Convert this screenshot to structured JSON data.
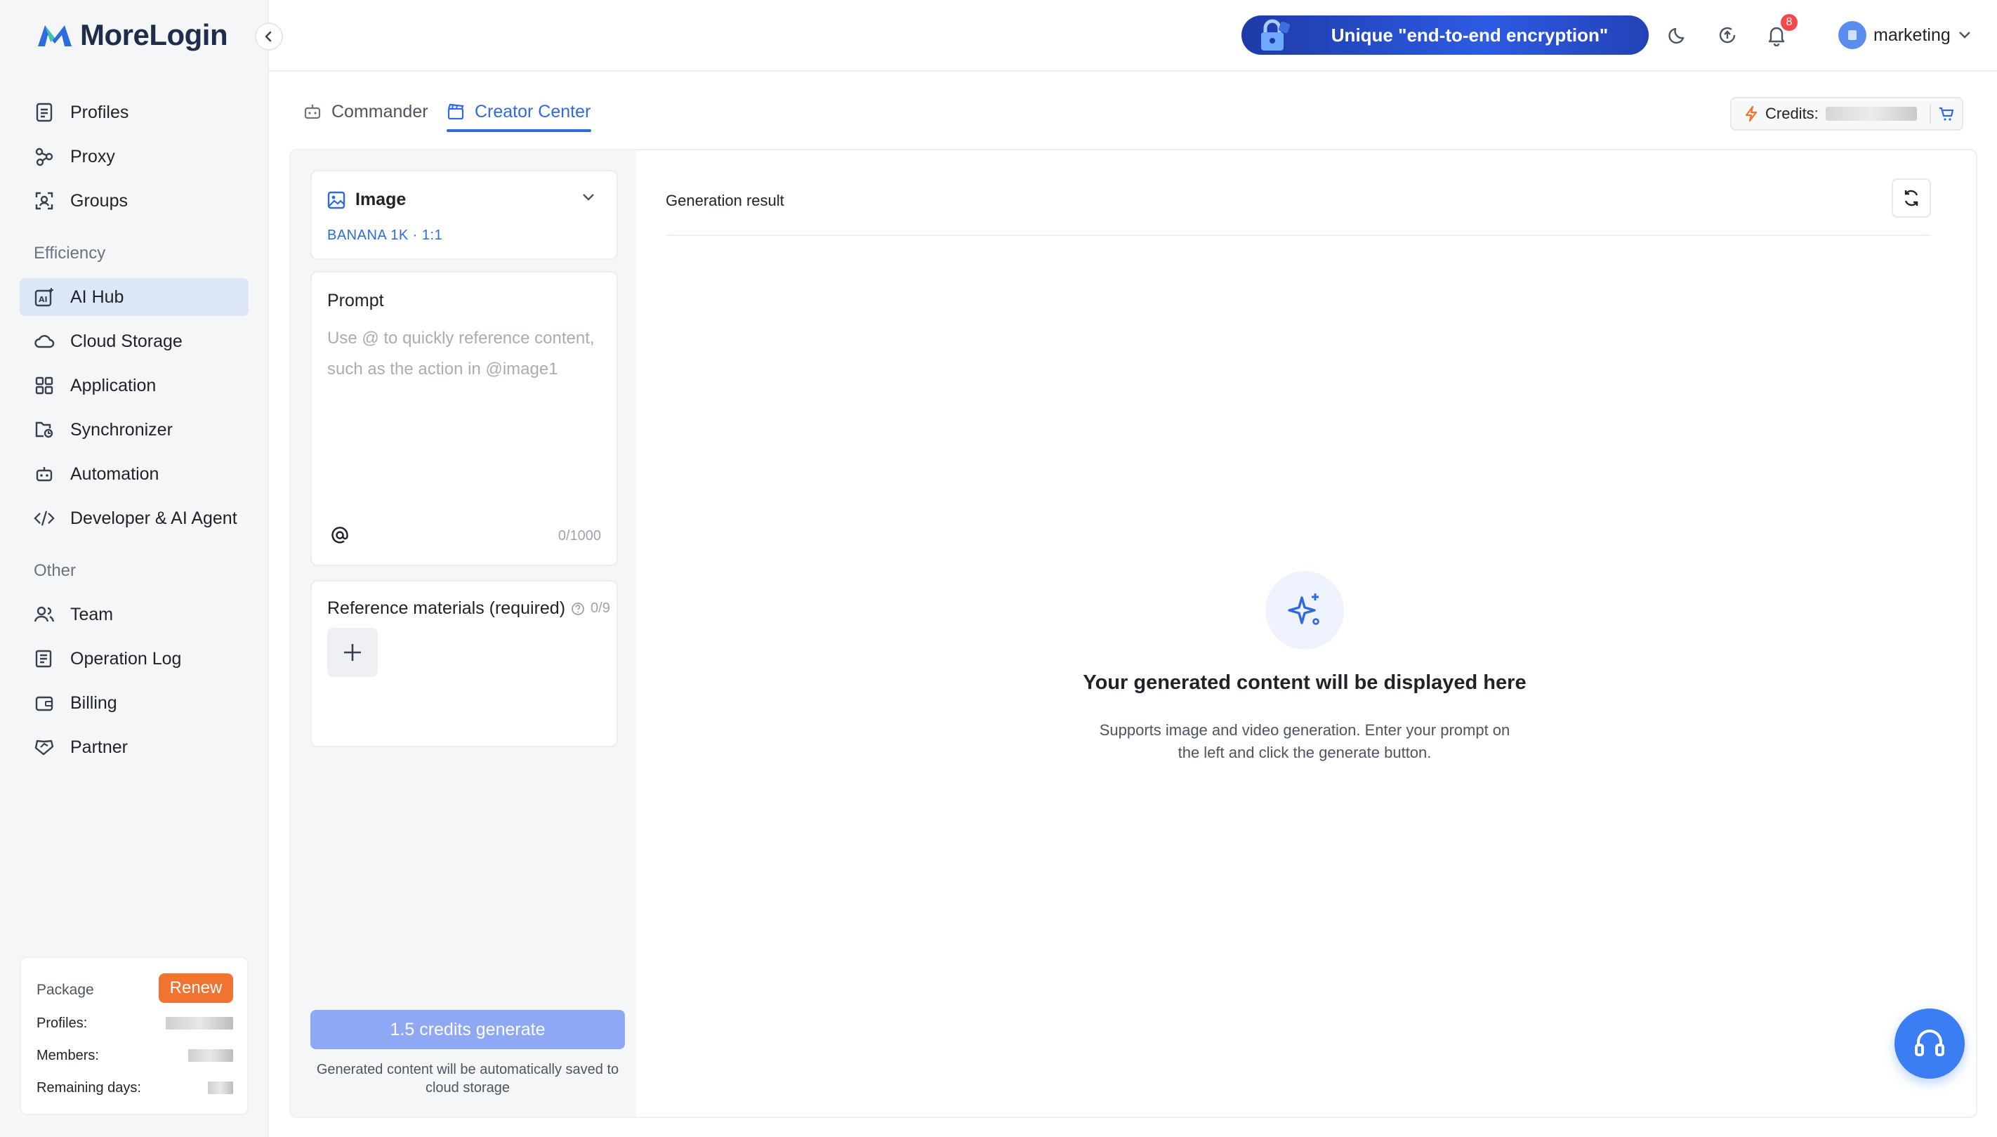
{
  "app": {
    "name": "MoreLogin"
  },
  "sidebar": {
    "items_top": [
      {
        "label": "Profiles",
        "icon": "document-icon"
      },
      {
        "label": "Proxy",
        "icon": "proxy-icon"
      },
      {
        "label": "Groups",
        "icon": "groups-icon"
      }
    ],
    "section_efficiency": "Efficiency",
    "items_efficiency": [
      {
        "label": "AI Hub",
        "icon": "ai-hub-icon",
        "active": true
      },
      {
        "label": "Cloud Storage",
        "icon": "cloud-icon"
      },
      {
        "label": "Application",
        "icon": "grid-icon"
      },
      {
        "label": "Synchronizer",
        "icon": "sync-folder-icon"
      },
      {
        "label": "Automation",
        "icon": "robot-icon"
      },
      {
        "label": "Developer & AI Agent",
        "icon": "code-icon"
      }
    ],
    "section_other": "Other",
    "items_other": [
      {
        "label": "Team",
        "icon": "team-icon"
      },
      {
        "label": "Operation Log",
        "icon": "log-icon"
      },
      {
        "label": "Billing",
        "icon": "wallet-icon"
      },
      {
        "label": "Partner",
        "icon": "handshake-icon"
      }
    ],
    "package": {
      "title": "Package",
      "renew_label": "Renew",
      "profiles_label": "Profiles:",
      "members_label": "Members:",
      "remaining_days_label": "Remaining days:"
    }
  },
  "topbar": {
    "promo_text": "Unique \"end-to-end encryption\"",
    "notification_count": "8",
    "username": "marketing"
  },
  "tabs": [
    {
      "label": "Commander",
      "icon": "robot-icon"
    },
    {
      "label": "Creator Center",
      "icon": "clapperboard-icon",
      "active": true
    }
  ],
  "credits": {
    "label": "Credits:"
  },
  "left_panel": {
    "media_type": "Image",
    "model_info": "BANANA  1K · 1:1",
    "prompt_label": "Prompt",
    "prompt_placeholder": "Use @ to quickly reference content, such as the action in @image1",
    "prompt_value": "",
    "char_counter": "0/1000",
    "reference_label": "Reference materials (required)",
    "reference_count": "0/9",
    "generate_label": "1.5 credits generate",
    "generate_note": "Generated content will be automatically saved to cloud storage"
  },
  "result": {
    "title": "Generation result",
    "empty_title": "Your generated content will be displayed here",
    "empty_desc": "Supports image and video generation. Enter your prompt on the left and click the generate button."
  },
  "colors": {
    "accent": "#2f6bde",
    "renew": "#f0742f",
    "generate_disabled": "#8fa8f4",
    "active_nav": "#dde7f8"
  }
}
